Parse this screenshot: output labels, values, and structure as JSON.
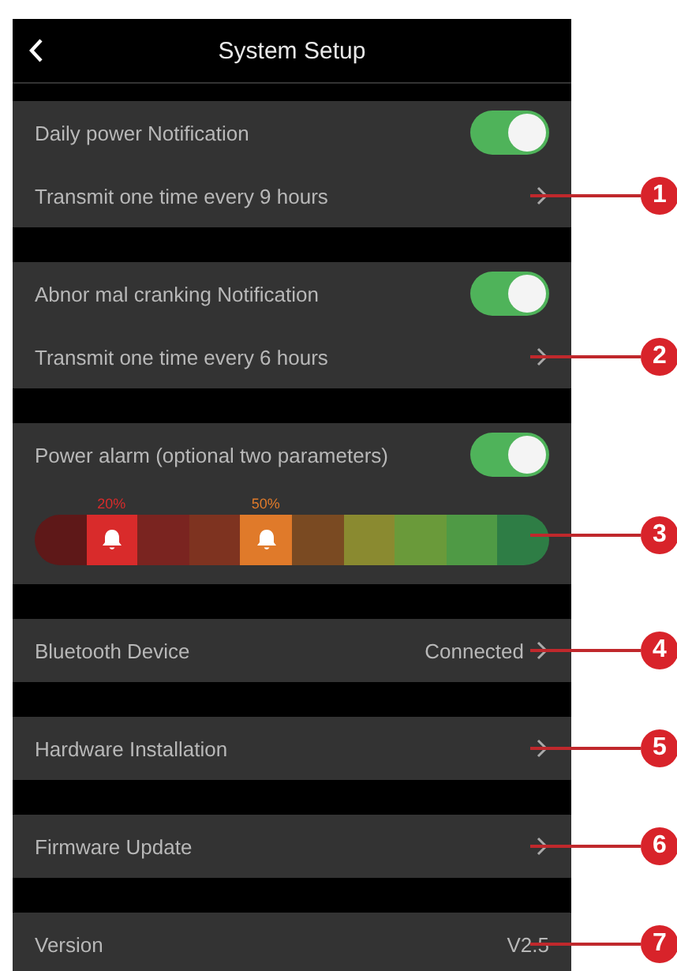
{
  "header": {
    "title": "System Setup"
  },
  "groups": [
    {
      "rows": [
        {
          "kind": "toggle",
          "label": "Daily power Notification",
          "on": true
        },
        {
          "kind": "link",
          "label": "Transmit one time every 9 hours",
          "callout": "1"
        }
      ]
    },
    {
      "rows": [
        {
          "kind": "toggle",
          "label": "Abnor mal cranking Notification",
          "on": true
        },
        {
          "kind": "link",
          "label": "Transmit one time every 6 hours",
          "callout": "2"
        }
      ]
    },
    {
      "rows": [
        {
          "kind": "toggle",
          "label": "Power alarm (optional two parameters)",
          "on": true
        },
        {
          "kind": "alarm-bar",
          "callout": "3",
          "markers": [
            {
              "label": "20%",
              "level": 0.2,
              "color": "#d92b2b"
            },
            {
              "label": "50%",
              "level": 0.5,
              "color": "#e07a2a"
            }
          ]
        }
      ]
    },
    {
      "rows": [
        {
          "kind": "link",
          "label": "Bluetooth Device",
          "value": "Connected",
          "callout": "4"
        }
      ]
    },
    {
      "rows": [
        {
          "kind": "link",
          "label": "Hardware Installation",
          "callout": "5"
        }
      ]
    },
    {
      "rows": [
        {
          "kind": "link",
          "label": "Firmware Update",
          "callout": "6"
        }
      ]
    },
    {
      "rows": [
        {
          "kind": "value",
          "label": "Version",
          "value": "V2.5",
          "callout": "7"
        }
      ]
    }
  ]
}
